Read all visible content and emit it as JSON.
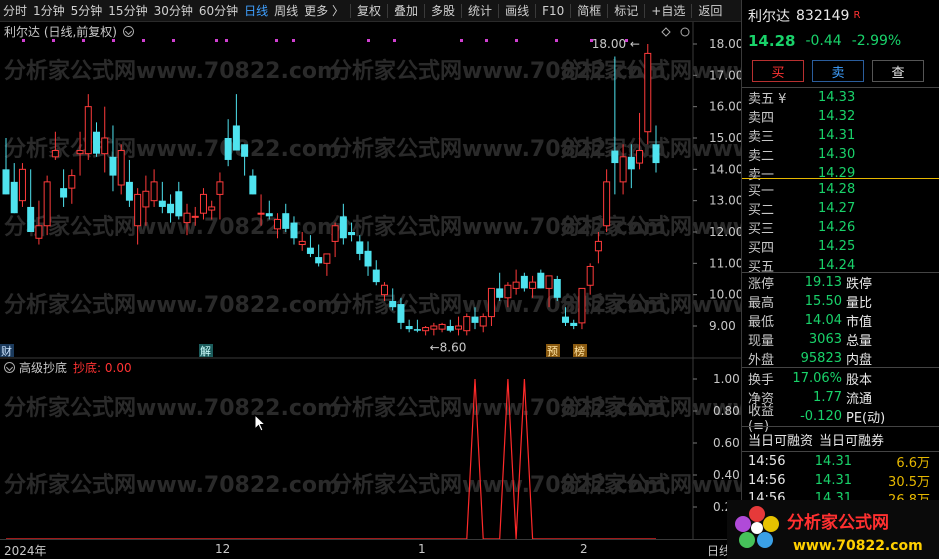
{
  "toolbar": {
    "items": [
      "分时",
      "1分钟",
      "5分钟",
      "15分钟",
      "30分钟",
      "60分钟",
      "日线",
      "周线",
      "更多 〉"
    ],
    "active_index": 6,
    "tools": [
      "复权",
      "叠加",
      "多股",
      "统计",
      "画线",
      "F10",
      "简框",
      "标记",
      "+自选",
      "返回"
    ]
  },
  "chart": {
    "title": "利尔达 (日线,前复权)",
    "watermark": "分析家公式网www.70822.com",
    "high_annotation": "18.00",
    "low_annotation": "8.60",
    "marker_cai": "财",
    "marker_jie": "解",
    "marker_yu": "预",
    "marker_bang": "榜"
  },
  "chart_data": [
    {
      "type": "candlestick",
      "title": "利尔达 (日线,前复权)",
      "yticks": [
        "18.00",
        "17.00",
        "16.00",
        "15.00",
        "14.00",
        "13.00",
        "12.00",
        "11.00",
        "10.00",
        "9.00"
      ],
      "ylim": [
        8.3,
        18.3
      ],
      "candles": [
        [
          14.0,
          15.0,
          13.2,
          13.2
        ],
        [
          13.6,
          14.2,
          12.6,
          12.6
        ],
        [
          13.0,
          14.2,
          12.8,
          14.0
        ],
        [
          12.8,
          14.0,
          12.0,
          12.0
        ],
        [
          11.8,
          13.0,
          11.6,
          12.2
        ],
        [
          12.2,
          13.8,
          11.9,
          13.6
        ],
        [
          14.4,
          15.2,
          14.3,
          14.6
        ],
        [
          13.4,
          14.0,
          12.8,
          13.1
        ],
        [
          13.4,
          14.0,
          12.9,
          13.8
        ],
        [
          14.5,
          15.2,
          13.8,
          14.6
        ],
        [
          14.5,
          16.4,
          14.3,
          16.0
        ],
        [
          15.2,
          15.5,
          14.4,
          14.5
        ],
        [
          14.5,
          16.0,
          13.9,
          15.0
        ],
        [
          14.4,
          15.4,
          13.3,
          13.8
        ],
        [
          13.5,
          14.8,
          13.2,
          14.6
        ],
        [
          13.6,
          14.3,
          12.8,
          13.0
        ],
        [
          12.2,
          13.4,
          11.6,
          13.2
        ],
        [
          12.8,
          13.8,
          12.2,
          13.3
        ],
        [
          13.0,
          14.0,
          12.8,
          13.6
        ],
        [
          13.0,
          13.6,
          12.6,
          12.8
        ],
        [
          12.9,
          13.2,
          12.3,
          12.6
        ],
        [
          13.3,
          13.6,
          12.4,
          12.5
        ],
        [
          12.3,
          12.9,
          11.9,
          12.6
        ],
        [
          12.5,
          12.8,
          12.2,
          12.5
        ],
        [
          12.6,
          13.4,
          12.4,
          13.2
        ],
        [
          12.7,
          13.0,
          12.4,
          12.8
        ],
        [
          13.2,
          13.9,
          12.4,
          13.6
        ],
        [
          15.0,
          15.6,
          14.1,
          14.3
        ],
        [
          15.4,
          16.4,
          14.6,
          14.6
        ],
        [
          14.8,
          14.8,
          13.8,
          14.4
        ],
        [
          13.8,
          14.0,
          13.2,
          13.2
        ],
        [
          12.6,
          13.2,
          12.2,
          12.6
        ],
        [
          12.6,
          13.0,
          12.4,
          12.5
        ],
        [
          12.1,
          12.6,
          11.8,
          12.4
        ],
        [
          12.6,
          12.9,
          12.0,
          12.1
        ],
        [
          12.3,
          12.5,
          11.6,
          11.8
        ],
        [
          11.6,
          12.0,
          11.4,
          11.7
        ],
        [
          11.5,
          11.9,
          11.2,
          11.3
        ],
        [
          11.2,
          11.6,
          10.9,
          11.0
        ],
        [
          11.0,
          11.3,
          10.6,
          11.3
        ],
        [
          11.7,
          12.3,
          11.2,
          12.2
        ],
        [
          12.5,
          12.9,
          11.6,
          11.8
        ],
        [
          12.0,
          12.3,
          11.7,
          11.9
        ],
        [
          11.7,
          11.9,
          11.1,
          11.3
        ],
        [
          11.4,
          11.7,
          10.6,
          10.9
        ],
        [
          10.8,
          11.1,
          10.3,
          10.4
        ],
        [
          10.0,
          10.4,
          9.8,
          10.3
        ],
        [
          9.8,
          10.2,
          9.5,
          9.6
        ],
        [
          9.7,
          9.9,
          8.9,
          9.1
        ],
        [
          9.0,
          9.2,
          8.8,
          8.9
        ],
        [
          8.9,
          9.2,
          8.8,
          8.85
        ],
        [
          8.85,
          9.0,
          8.7,
          8.95
        ],
        [
          8.9,
          9.1,
          8.7,
          9.0
        ],
        [
          8.9,
          9.1,
          8.8,
          9.05
        ],
        [
          9.0,
          9.2,
          8.8,
          8.85
        ],
        [
          8.9,
          9.3,
          8.7,
          9.0
        ],
        [
          8.85,
          9.4,
          8.7,
          9.3
        ],
        [
          9.3,
          9.6,
          8.9,
          9.1
        ],
        [
          9.0,
          9.4,
          8.8,
          9.3
        ],
        [
          9.3,
          10.2,
          9.0,
          10.2
        ],
        [
          10.2,
          10.7,
          9.8,
          9.9
        ],
        [
          9.9,
          10.4,
          9.6,
          10.3
        ],
        [
          10.2,
          10.8,
          10.0,
          10.4
        ],
        [
          10.6,
          10.7,
          10.1,
          10.2
        ],
        [
          10.2,
          10.6,
          9.9,
          10.4
        ],
        [
          10.7,
          10.8,
          10.2,
          10.2
        ],
        [
          10.2,
          10.6,
          9.6,
          10.6
        ],
        [
          10.5,
          10.6,
          9.8,
          9.9
        ],
        [
          9.3,
          9.6,
          9.0,
          9.1
        ],
        [
          9.1,
          9.2,
          8.9,
          9.0
        ],
        [
          9.1,
          10.2,
          8.9,
          10.2
        ],
        [
          10.3,
          11.0,
          10.0,
          10.9
        ],
        [
          11.4,
          12.0,
          11.0,
          11.7
        ],
        [
          12.2,
          14.0,
          12.0,
          13.6
        ],
        [
          14.6,
          17.6,
          13.2,
          14.2
        ],
        [
          13.6,
          14.8,
          13.2,
          14.4
        ],
        [
          14.4,
          14.8,
          13.4,
          14.0
        ],
        [
          14.2,
          15.8,
          14.0,
          14.6
        ],
        [
          15.2,
          18.0,
          14.8,
          17.7
        ],
        [
          14.8,
          15.4,
          13.9,
          14.2
        ]
      ]
    },
    {
      "type": "line",
      "title": "高级抄底",
      "series": [
        {
          "name": "抄底",
          "last": "0.00"
        }
      ],
      "yticks": [
        "1.00",
        "0.80",
        "0.60",
        "0.40",
        "0.20"
      ],
      "ylim": [
        0,
        1
      ],
      "spikes": [
        57,
        61,
        63
      ]
    }
  ],
  "xaxis": {
    "labels": [
      "2024年",
      "12",
      "1",
      "2"
    ],
    "right": "日线"
  },
  "indicator": {
    "title": "高级抄底",
    "series_label": "抄底: 0.00"
  },
  "quote": {
    "name": "利尔达",
    "code": "832149",
    "flag": "R",
    "price": "14.28",
    "change": "-0.44",
    "pct": "-2.99%",
    "buy_btn": "买",
    "sell_btn": "卖",
    "query_btn": "查",
    "asks": [
      {
        "label": "卖五 ¥",
        "price": "14.33"
      },
      {
        "label": "卖四",
        "price": "14.32"
      },
      {
        "label": "卖三",
        "price": "14.31"
      },
      {
        "label": "卖二",
        "price": "14.30"
      },
      {
        "label": "卖一",
        "price": "14.29"
      }
    ],
    "bids": [
      {
        "label": "买一",
        "price": "14.28"
      },
      {
        "label": "买二",
        "price": "14.27"
      },
      {
        "label": "买三",
        "price": "14.26"
      },
      {
        "label": "买四",
        "price": "14.25"
      },
      {
        "label": "买五",
        "price": "14.24"
      }
    ],
    "stats": {
      "zhangting_lbl": "涨停",
      "zhangting": "19.13",
      "dieting_lbl": "跌停",
      "high_lbl": "最高",
      "high": "15.50",
      "liangbi_lbl": "量比",
      "low_lbl": "最低",
      "low": "14.04",
      "shizhi_lbl": "市值",
      "volume_lbl": "现量",
      "volume": "3063",
      "zongliang_lbl": "总量",
      "waipan_lbl": "外盘",
      "waipan": "95823",
      "neipan_lbl": "内盘"
    },
    "fin": {
      "huanshou_lbl": "换手",
      "huanshou": "17.06%",
      "guben_lbl": "股本",
      "jingzi_lbl": "净资",
      "jingzi": "1.77",
      "liutong_lbl": "流通",
      "shouyi_lbl": "收益(≡)",
      "shouyi": "-0.120",
      "pe_lbl": "PE(动)"
    },
    "margin": {
      "left": "当日可融资",
      "right": "当日可融券"
    },
    "trades": [
      {
        "time": "14:56",
        "price": "14.31",
        "vol": "6.6万"
      },
      {
        "time": "14:56",
        "price": "14.31",
        "vol": "30.5万"
      },
      {
        "time": "14:56",
        "price": "14.31",
        "vol": "26.8万"
      }
    ]
  },
  "logo": {
    "text": "分析家公式网",
    "url": "www.70822.com"
  },
  "colors": {
    "up": "#ff3b3b",
    "down": "#4fe3ef",
    "accent": "#3fa0ff"
  }
}
